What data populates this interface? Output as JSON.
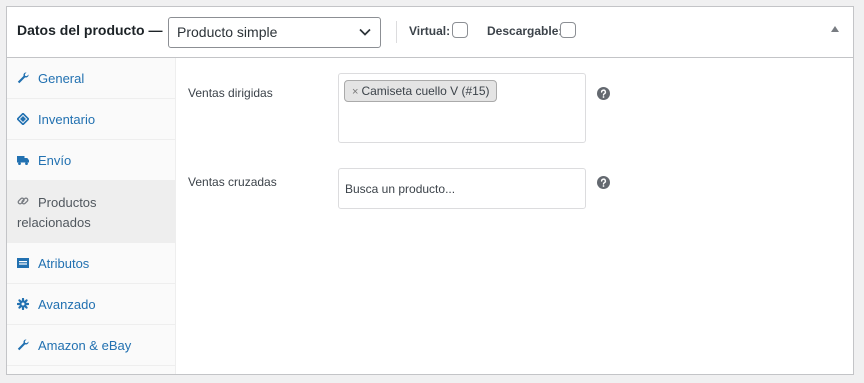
{
  "header": {
    "title": "Datos del producto —",
    "product_type": "Producto simple",
    "virtual_label": "Virtual:",
    "downloadable_label": "Descargable:"
  },
  "tabs": [
    {
      "label": "General",
      "icon": "wrench-icon"
    },
    {
      "label": "Inventario",
      "icon": "tag-icon"
    },
    {
      "label": "Envío",
      "icon": "truck-icon"
    },
    {
      "label": "Productos relacionados",
      "icon": "link-icon"
    },
    {
      "label": "Atributos",
      "icon": "list-icon"
    },
    {
      "label": "Avanzado",
      "icon": "gear-icon"
    },
    {
      "label": "Amazon & eBay",
      "icon": "wrench-icon"
    }
  ],
  "active_tab": "Productos relacionados",
  "fields": {
    "upsells_label": "Ventas dirigidas",
    "upsells_chip_remove": "×",
    "upsells_chip": "Camiseta cuello V (#15)",
    "crosssells_label": "Ventas cruzadas",
    "crosssells_placeholder": "Busca un producto..."
  },
  "colors": {
    "link": "#2271b1",
    "border": "#c3c4c7",
    "chip_bg": "#e4e4e4"
  }
}
